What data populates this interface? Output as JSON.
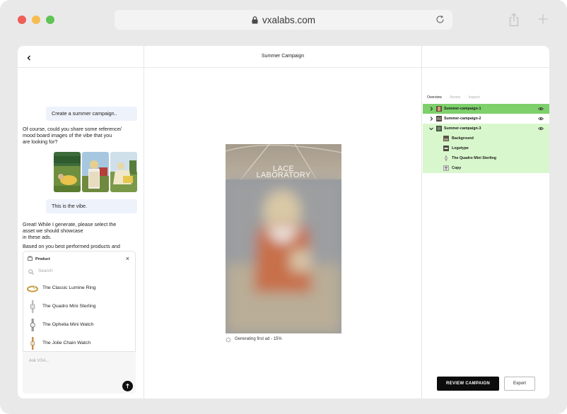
{
  "browser": {
    "url": "vxalabs.com"
  },
  "header": {
    "title": "Summer Campaign"
  },
  "chat": {
    "user_message_1": "Create a summer campaign..",
    "ai_message_1_lines": [
      "Of course, could you share some reference/",
      "mood board images of the vibe that you",
      "are looking for?"
    ],
    "user_message_2": "This is the vibe.",
    "ai_message_2_lines": [
      "Great! While I generate, please select the",
      "asset we should showcase",
      "in these ads."
    ],
    "ai_message_3_lines": [
      "Based on you best performed products and"
    ]
  },
  "product_picker": {
    "title": "Product",
    "search_placeholder": "Search",
    "items": [
      {
        "label": "The Classic Lumine Ring",
        "icon": "ring-icon"
      },
      {
        "label": "The Quadro Mini Sterling",
        "icon": "watch-icon"
      },
      {
        "label": "The Ophelia Mini Watch",
        "icon": "watch-icon"
      },
      {
        "label": "The Jolie Chain Watch",
        "icon": "watch-icon"
      }
    ]
  },
  "composer": {
    "placeholder": "Ask VXA..."
  },
  "preview": {
    "brand_line_1": "LACE",
    "brand_line_2": "LABORATORY",
    "status": "Generating first ad - 15%"
  },
  "layers_panel": {
    "tabs": [
      "Overview",
      "Assets",
      "Inspect"
    ],
    "active_tab": "Overview",
    "layers": [
      {
        "label": "Summer-campaign-1",
        "expanded": false,
        "selected": true
      },
      {
        "label": "Summer-campaign-2",
        "expanded": false,
        "selected": false
      },
      {
        "label": "Summer-campaign-3",
        "expanded": true,
        "selected": false
      }
    ],
    "sublayers": [
      "Background",
      "Logotype",
      "The Quadro Mini Sterling",
      "Copy"
    ]
  },
  "actions": {
    "review_label": "REVIEW CAMPAIGN",
    "export_label": "Export"
  },
  "colors": {
    "selected_layer": "#7ed06b",
    "group_highlight": "#d8f7cc",
    "chat_bubble": "#eef2fb",
    "primary_button": "#0c0c0c"
  }
}
